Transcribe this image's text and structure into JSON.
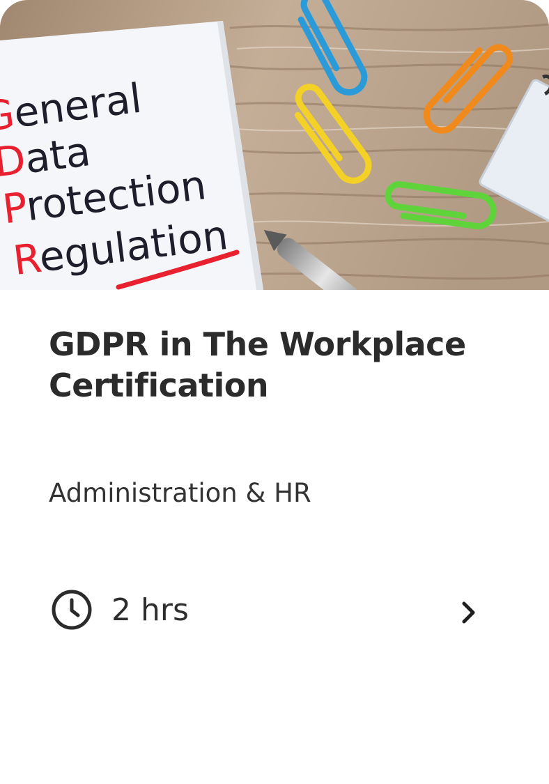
{
  "card": {
    "title": "GDPR in The Workplace Certification",
    "category": "Administration & HR",
    "duration": "2 hrs"
  },
  "hero": {
    "note_lines": [
      {
        "initial": "G",
        "rest": "eneral"
      },
      {
        "initial": "D",
        "rest": "ata"
      },
      {
        "initial": "P",
        "rest": "rotection"
      },
      {
        "initial": "R",
        "rest": "egulation"
      }
    ]
  },
  "icons": {
    "duration": "clock-icon",
    "open": "chevron-right-icon"
  },
  "colors": {
    "title": "#2b2b2b",
    "text": "#333333",
    "note_red": "#e8202f",
    "wood": "#b89f86"
  }
}
